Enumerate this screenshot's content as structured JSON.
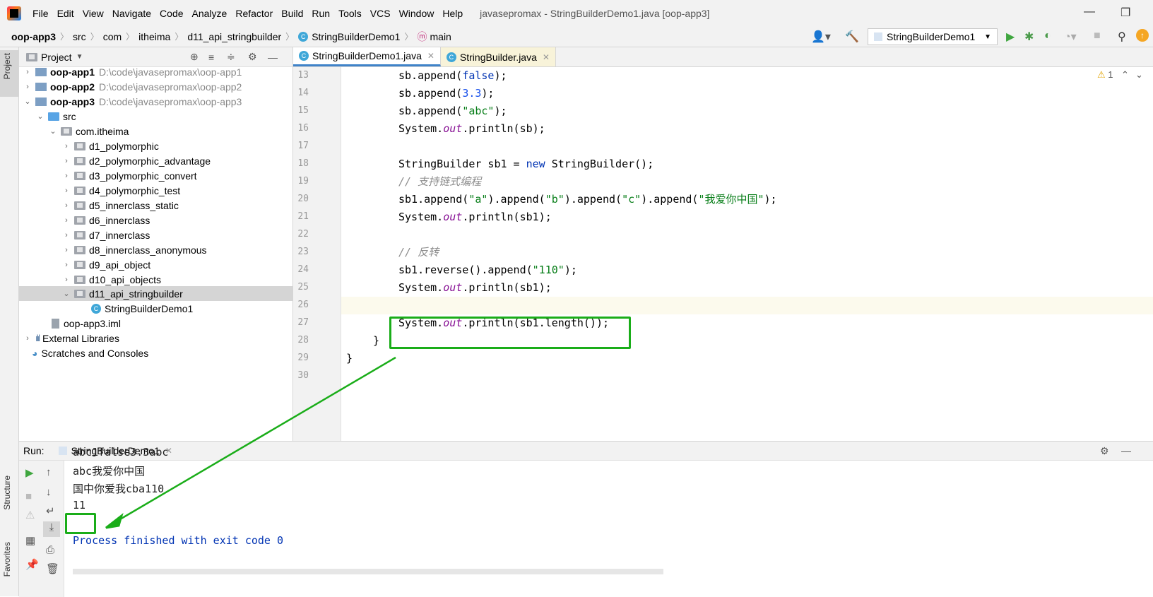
{
  "menubar": {
    "items": [
      "File",
      "Edit",
      "View",
      "Navigate",
      "Code",
      "Analyze",
      "Refactor",
      "Build",
      "Run",
      "Tools",
      "VCS",
      "Window",
      "Help"
    ],
    "window_title": "javasepromax - StringBuilderDemo1.java [oop-app3]"
  },
  "breadcrumb": {
    "items": [
      "oop-app3",
      "src",
      "com",
      "itheima",
      "d11_api_stringbuilder",
      "StringBuilderDemo1",
      "main"
    ]
  },
  "toolbar": {
    "run_config": "StringBuilderDemo1"
  },
  "left_stripe": {
    "project": "Project",
    "structure": "Structure",
    "favorites": "Favorites"
  },
  "project_panel": {
    "title": "Project",
    "rows": [
      {
        "label": "oop-app1",
        "path": "D:\\code\\javasepromax\\oop-app1"
      },
      {
        "label": "oop-app2",
        "path": "D:\\code\\javasepromax\\oop-app2"
      },
      {
        "label": "oop-app3",
        "path": "D:\\code\\javasepromax\\oop-app3"
      },
      {
        "label": "src"
      },
      {
        "label": "com.itheima"
      },
      {
        "label": "d1_polymorphic"
      },
      {
        "label": "d2_polymorphic_advantage"
      },
      {
        "label": "d3_polymorphic_convert"
      },
      {
        "label": "d4_polymorphic_test"
      },
      {
        "label": "d5_innerclass_static"
      },
      {
        "label": "d6_innerclass"
      },
      {
        "label": "d7_innerclass"
      },
      {
        "label": "d8_innerclass_anonymous"
      },
      {
        "label": "d9_api_object"
      },
      {
        "label": "d10_api_objects"
      },
      {
        "label": "d11_api_stringbuilder"
      },
      {
        "label": "StringBuilderDemo1"
      },
      {
        "label": "oop-app3.iml"
      },
      {
        "label": "External Libraries"
      },
      {
        "label": "Scratches and Consoles"
      }
    ]
  },
  "editor": {
    "tabs": [
      {
        "label": "StringBuilderDemo1.java",
        "active": true
      },
      {
        "label": "StringBuilder.java",
        "active": false
      }
    ],
    "warning_count": "1",
    "line_numbers": [
      "13",
      "14",
      "15",
      "16",
      "17",
      "18",
      "19",
      "20",
      "21",
      "22",
      "23",
      "24",
      "25",
      "26",
      "27",
      "28",
      "29",
      "30"
    ],
    "lines": {
      "l13": {
        "a": "sb.append(",
        "b": "false",
        "c": ");"
      },
      "l14": {
        "a": "sb.append(",
        "b": "3.3",
        "c": ");"
      },
      "l15": {
        "a": "sb.append(",
        "b": "\"abc\"",
        "c": ");"
      },
      "l16": {
        "a": "System.",
        "b": "out",
        "c": ".println(sb);"
      },
      "l18": {
        "a": "StringBuilder sb1 = ",
        "b": "new",
        "c": " StringBuilder();"
      },
      "l19": {
        "a": "// 支持链式编程"
      },
      "l20": {
        "a": "sb1.append(",
        "b": "\"a\"",
        "c": ").append(",
        "d": "\"b\"",
        "e": ").append(",
        "f": "\"c\"",
        "g": ").append(",
        "h": "\"我爱你中国\"",
        "i": ");"
      },
      "l21": {
        "a": "System.",
        "b": "out",
        "c": ".println(sb1);"
      },
      "l23": {
        "a": "// 反转"
      },
      "l24": {
        "a": "sb1.reverse().append(",
        "b": "\"110\"",
        "c": ");"
      },
      "l25": {
        "a": "System.",
        "b": "out",
        "c": ".println(sb1);"
      },
      "l27": {
        "a": "System.",
        "b": "out",
        "c": ".println(sb1.length());"
      },
      "l28": {
        "a": "}"
      },
      "l29": {
        "a": "}"
      }
    }
  },
  "run_panel": {
    "label": "Run:",
    "tab": "StringBuilderDemo1",
    "output": [
      "abc1false3.3abc",
      "abc我爱你中国",
      "国中你爱我cba110",
      "11",
      "",
      "Process finished with exit code 0"
    ]
  },
  "colors": {
    "annotation_green": "#1aad19",
    "keyword": "#0033b3",
    "string": "#067d17",
    "number": "#1750eb",
    "field": "#871094"
  }
}
